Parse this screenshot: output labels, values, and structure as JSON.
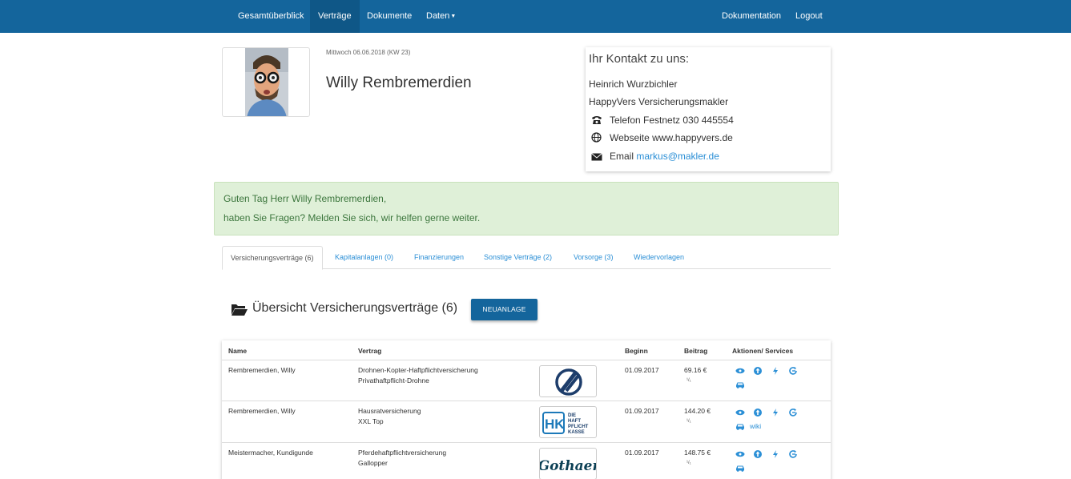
{
  "nav": {
    "left": [
      {
        "label": "Gesamtüberblick",
        "active": false
      },
      {
        "label": "Verträge",
        "active": true
      },
      {
        "label": "Dokumente",
        "active": false
      },
      {
        "label": "Daten",
        "active": false
      }
    ],
    "right": [
      {
        "label": "Dokumentation"
      },
      {
        "label": "Logout"
      }
    ]
  },
  "profile": {
    "date": "Mittwoch 06.06.2018 (KW 23)",
    "name": "Willy Rembremerdien"
  },
  "contact": {
    "title": "Ihr Kontakt zu uns:",
    "person": "Heinrich Wurzbichler",
    "company": "HappyVers Versicherungsmakler",
    "phone": "Telefon Festnetz 030 445554",
    "website": "Webseite www.happyvers.de",
    "email_label": "Email",
    "email": "markus@makler.de"
  },
  "alert": {
    "line1": "Guten Tag Herr Willy Rembremerdien,",
    "line2": "haben Sie Fragen? Melden Sie sich, wir helfen gerne weiter."
  },
  "tabs": [
    {
      "label": "Versicherungsverträge (6)",
      "active": true
    },
    {
      "label": "Kapitalanlagen (0)",
      "active": false
    },
    {
      "label": "Finanzierungen",
      "active": false
    },
    {
      "label": "Sonstige Verträge (2)",
      "active": false
    },
    {
      "label": "Vorsorge (3)",
      "active": false
    },
    {
      "label": "Wiedervorlagen",
      "active": false
    }
  ],
  "section": {
    "title": "Übersicht Versicherungsverträge (6)",
    "new_button": "NEUANLAGE"
  },
  "table": {
    "headers": {
      "name": "Name",
      "contract": "Vertrag",
      "start": "Beginn",
      "fee": "Beitrag",
      "actions": "Aktionen/ Services"
    },
    "rows": [
      {
        "name": "Rembremerdien, Willy",
        "contract": "Drohnen-Kopter-Haftpflichtversicherung",
        "tariff": "Privathaftpflicht-Drohne",
        "logo": "circle-slash-logo",
        "start": "01.09.2017",
        "fee": "69.16 €",
        "period": "¹/₁",
        "wiki": ""
      },
      {
        "name": "Rembremerdien, Willy",
        "contract": "Hausratversicherung",
        "tariff": "XXL Top",
        "logo": "hk-logo",
        "logo_text": "HK",
        "logo_sub1": "DIE",
        "logo_sub2": "HAFT",
        "logo_sub3": "PFLICHT",
        "logo_sub4": "KASSE",
        "start": "01.09.2017",
        "fee": "144.20 €",
        "period": "¹/₁",
        "wiki": "wiki"
      },
      {
        "name": "Meistermacher, Kundigunde",
        "contract": "Pferdehaftpflichtversicherung",
        "tariff": "Gallopper",
        "logo": "gothaer-logo",
        "logo_text": "Gothaer",
        "start": "01.09.2017",
        "fee": "148.75 €",
        "period": "¹/₁",
        "wiki": ""
      }
    ]
  },
  "colors": {
    "brand": "#14659c",
    "link": "#2b8fd6",
    "alert_bg": "#dff0d8",
    "alert_text": "#3c763d"
  }
}
